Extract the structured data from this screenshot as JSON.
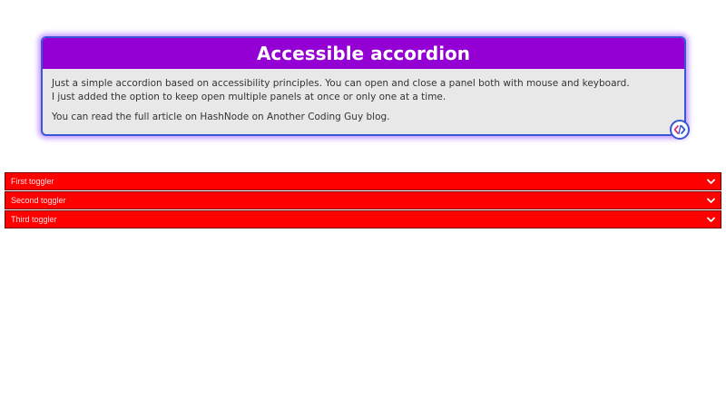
{
  "info": {
    "title": "Accessible accordion",
    "line1": "Just a simple accordion based on accessibility principles. You can open and close a panel both with mouse and keyboard.",
    "line2": "I just added the option to keep open multiple panels at once or only one at a time.",
    "line3": "You can read the full article on HashNode on Another Coding Guy blog."
  },
  "accordion": {
    "items": [
      {
        "label": "First toggler"
      },
      {
        "label": "Second toggler"
      },
      {
        "label": "Third toggler"
      }
    ]
  },
  "colors": {
    "header_bg": "#9400d3",
    "toggler_bg": "#ff0000",
    "card_bg": "#e8e8e8",
    "card_border": "#3a55d6"
  },
  "icons": {
    "badge": "code-logo-icon",
    "toggler": "chevron-down-icon"
  }
}
